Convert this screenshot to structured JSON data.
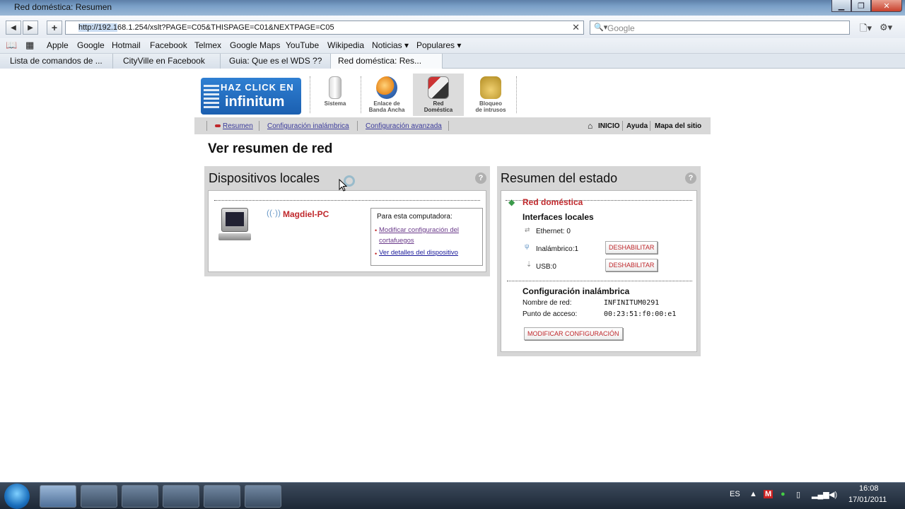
{
  "window": {
    "title": "Red doméstica: Resumen",
    "controls": {
      "minimize": "▁",
      "maximize": "❐",
      "close": "✕"
    }
  },
  "navbar": {
    "back_icon": "◀",
    "forward_icon": "▶",
    "new_tab_icon": "+",
    "url_selected": "http://192.1",
    "url_rest": "68.1.254/xslt?PAGE=C05&THISPAGE=C01&NEXTPAGE=C05",
    "url_clear_icon": "✕",
    "search_icon": "🔍▾",
    "search_placeholder": "Google",
    "page_menu_icon": "🗋▾",
    "tools_menu_icon": "⚙▾"
  },
  "bookmarks": {
    "book_icon": "📖",
    "grid_icon": "▦",
    "items": [
      "Apple",
      "Google",
      "Hotmail",
      "Facebook",
      "Telmex",
      "Google Maps",
      "YouTube",
      "Wikipedia",
      "Noticias ▾",
      "Populares ▾"
    ]
  },
  "tabs": [
    {
      "label": "Lista de comandos de ..."
    },
    {
      "label": "CityVille en Facebook"
    },
    {
      "label": "Guia: Que es el WDS ??"
    },
    {
      "label": "Red doméstica: Res..."
    }
  ],
  "router": {
    "logo_line1": "HAZ CLICK EN",
    "logo_line2": "infinitum",
    "nav": [
      {
        "label1": "Sistema",
        "label2": ""
      },
      {
        "label1": "Enlace de",
        "label2": "Banda Ancha"
      },
      {
        "label1": "Red",
        "label2": "Doméstica"
      },
      {
        "label1": "Bloqueo",
        "label2": "de intrusos"
      }
    ],
    "subnav": {
      "resumen": "Resumen",
      "config_inalambrica": "Configuración inalámbrica",
      "config_avanzada": "Configuración avanzada",
      "inicio": "INICIO",
      "ayuda": "Ayuda",
      "mapa": "Mapa del sitio"
    },
    "page_title": "Ver resumen de red",
    "local_devices": {
      "title": "Dispositivos locales",
      "help": "?",
      "device_name": "Magdiel-PC",
      "box_title": "Para esta computadora:",
      "link1": "Modificar configuración del cortafuegos",
      "link2": "Ver detalles del dispositivo"
    },
    "status_summary": {
      "title": "Resumen del estado",
      "help": "?",
      "home_network": "Red doméstica",
      "local_interfaces": "Interfaces locales",
      "ethernet": "Ethernet: 0",
      "wireless": "Inalámbrico:1",
      "usb": "USB:0",
      "disable_btn": "DESHABILITAR",
      "wireless_config": "Configuración inalámbrica",
      "network_name_label": "Nombre de red:",
      "network_name": "INFINITUM0291",
      "access_point_label": "Punto de acceso:",
      "access_point": "00:23:51:f0:00:e1",
      "modify_btn": "MODIFICAR CONFIGURACIÓN"
    }
  },
  "taskbar": {
    "lang": "ES",
    "time": "16:08",
    "date": "17/01/2011"
  }
}
